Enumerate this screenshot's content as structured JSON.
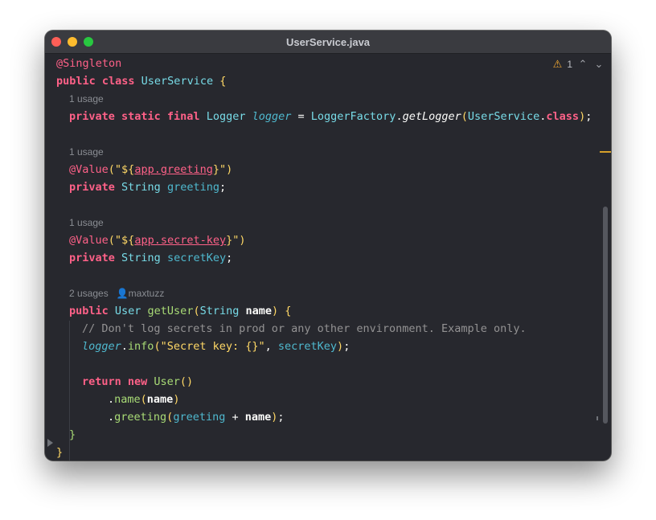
{
  "window": {
    "title": "UserService.java"
  },
  "toolbar": {
    "warning_count": "1",
    "warning_icon": "warning-triangle-icon",
    "prev_icon": "chevron-up-icon",
    "next_icon": "chevron-down-icon"
  },
  "code": {
    "l_singleton": "@Singleton",
    "l_class_kw": "public class ",
    "l_class_name": "UserService",
    "l_class_brace": " {",
    "h_usage1": "1 usage",
    "logger": {
      "mods": "private static final ",
      "type": "Logger ",
      "name": "logger",
      "eq": " = ",
      "factory": "LoggerFactory",
      "dot": ".",
      "method": "getLogger",
      "lp": "(",
      "arg": "UserService",
      "dot2": ".",
      "cls": "class",
      "rp": ")",
      "semi": ";"
    },
    "h_usage2": "1 usage",
    "greet_ann": "@Value",
    "greet_lp": "(",
    "greet_q1": "\"${",
    "greet_prop": "app.greeting",
    "greet_q2": "}\"",
    "greet_rp": ")",
    "greet_mods": "private ",
    "greet_type": "String ",
    "greet_name": "greeting",
    "greet_semi": ";",
    "h_usage3": "1 usage",
    "sec_ann": "@Value",
    "sec_lp": "(",
    "sec_q1": "\"${",
    "sec_prop": "app.secret-key",
    "sec_q2": "}\"",
    "sec_rp": ")",
    "sec_mods": "private ",
    "sec_type": "String ",
    "sec_name": "secretKey",
    "sec_semi": ";",
    "h_usage4": "2 usages",
    "h_author": "maxtuzz",
    "m_mods": "public ",
    "m_type": "User ",
    "m_name": "getUser",
    "m_lp": "(",
    "m_ptype": "String ",
    "m_pname": "name",
    "m_rp": ")",
    "m_brace": " {",
    "comment": "// Don't log secrets in prod or any other environment. Example only.",
    "log_obj": "logger",
    "log_dot": ".",
    "log_fn": "info",
    "log_lp": "(",
    "log_str": "\"Secret key: {}\"",
    "log_comma": ", ",
    "log_arg": "secretKey",
    "log_rp": ")",
    "log_semi": ";",
    "ret_kw": "return new ",
    "ret_type": "User",
    "ret_parens": "()",
    "n_dot": ".",
    "n_fn": "name",
    "n_lp": "(",
    "n_arg": "name",
    "n_rp": ")",
    "g_dot": ".",
    "g_fn": "greeting",
    "g_lp": "(",
    "g_arg": "greeting",
    "g_plus": " + ",
    "g_arg2": "name",
    "g_rp": ")",
    "g_semi": ";",
    "m_close": "}",
    "c_close": "}"
  }
}
